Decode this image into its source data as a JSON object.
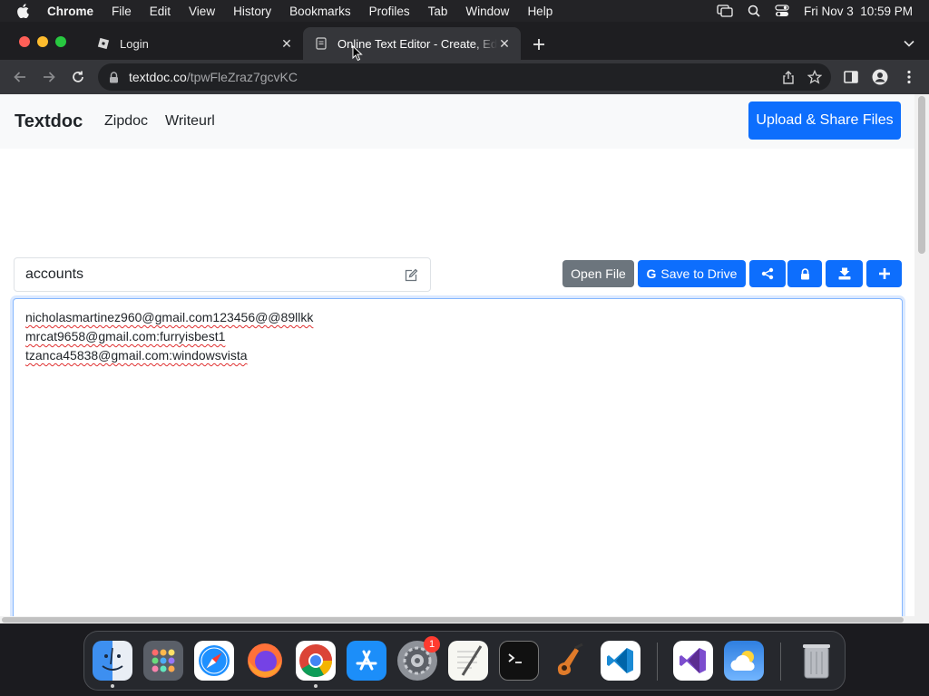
{
  "menubar": {
    "items": [
      "Chrome",
      "File",
      "Edit",
      "View",
      "History",
      "Bookmarks",
      "Profiles",
      "Tab",
      "Window",
      "Help"
    ],
    "clock": "Fri Nov 3  10:59 PM",
    "icons": [
      "apple-icon",
      "screen-mirroring-icon",
      "spotlight-search-icon",
      "control-center-icon"
    ]
  },
  "tabs": [
    {
      "title": "Login",
      "favicon": "roblox-icon"
    },
    {
      "title": "Online Text Editor - Create, Edit",
      "favicon": "textdoc-icon",
      "active": true
    }
  ],
  "address": {
    "host": "textdoc.co",
    "path": "/tpwFleZraz7gcvKC"
  },
  "site": {
    "brand": "Textdoc",
    "nav": [
      "Zipdoc",
      "Writeurl"
    ],
    "upload_button": "Upload & Share Files"
  },
  "doc": {
    "title_value": "accounts",
    "buttons": {
      "open_file": "Open File",
      "save_to_drive": "Save to Drive",
      "google_g": "G"
    },
    "icon_buttons": [
      "share-icon",
      "lock-icon",
      "download-icon",
      "plus-icon"
    ],
    "lines": [
      "nicholasmartinez960@gmail.com123456@@89llkk",
      "mrcat9658@gmail.com:furryisbest1",
      "tzanca45838@gmail.com:windowsvista"
    ]
  },
  "dock": {
    "apps": [
      "Finder",
      "Launchpad",
      "Safari",
      "Firefox",
      "Google Chrome",
      "App Store",
      "System Settings",
      "TextEdit",
      "Terminal",
      "GarageBand",
      "Visual Studio Code",
      "Visual Studio",
      "Weather",
      "Trash"
    ],
    "system_settings_badge": "1"
  },
  "colors": {
    "primary": "#0d6efd",
    "secondary": "#6c757d",
    "navbar": "#f8f9fa",
    "chrome_dark": "#35363a"
  }
}
